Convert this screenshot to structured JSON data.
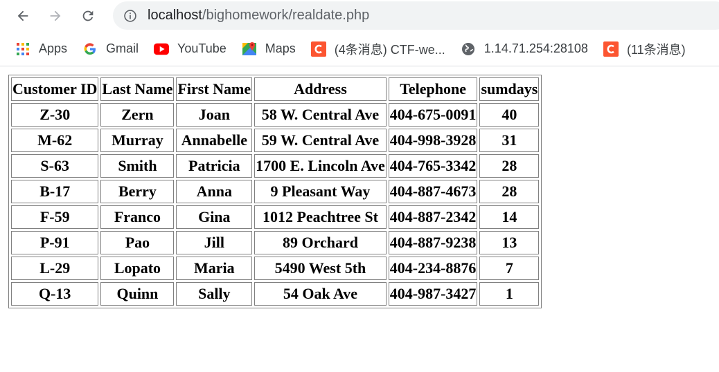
{
  "browser": {
    "url_host": "localhost",
    "url_path": "/bighomework/realdate.php"
  },
  "bookmarks": [
    {
      "label": "Apps",
      "icon": "apps-grid-icon"
    },
    {
      "label": "Gmail",
      "icon": "google-g-icon"
    },
    {
      "label": "YouTube",
      "icon": "youtube-icon"
    },
    {
      "label": "Maps",
      "icon": "maps-icon"
    },
    {
      "label": "(4条消息) CTF-we...",
      "icon": "csdn-icon"
    },
    {
      "label": "1.14.71.254:28108",
      "icon": "globe-icon"
    },
    {
      "label": "(11条消息)",
      "icon": "csdn-icon"
    }
  ],
  "table": {
    "headers": [
      "Customer ID",
      "Last Name",
      "First Name",
      "Address",
      "Telephone",
      "sumdays"
    ],
    "rows": [
      [
        "Z-30",
        "Zern",
        "Joan",
        "58 W. Central Ave",
        "404-675-0091",
        "40"
      ],
      [
        "M-62",
        "Murray",
        "Annabelle",
        "59 W. Central Ave",
        "404-998-3928",
        "31"
      ],
      [
        "S-63",
        "Smith",
        "Patricia",
        "1700 E. Lincoln Ave",
        "404-765-3342",
        "28"
      ],
      [
        "B-17",
        "Berry",
        "Anna",
        "9 Pleasant Way",
        "404-887-4673",
        "28"
      ],
      [
        "F-59",
        "Franco",
        "Gina",
        "1012 Peachtree St",
        "404-887-2342",
        "14"
      ],
      [
        "P-91",
        "Pao",
        "Jill",
        "89 Orchard",
        "404-887-9238",
        "13"
      ],
      [
        "L-29",
        "Lopato",
        "Maria",
        "5490 West 5th",
        "404-234-8876",
        "7"
      ],
      [
        "Q-13",
        "Quinn",
        "Sally",
        "54 Oak Ave",
        "404-987-3427",
        "1"
      ]
    ]
  }
}
